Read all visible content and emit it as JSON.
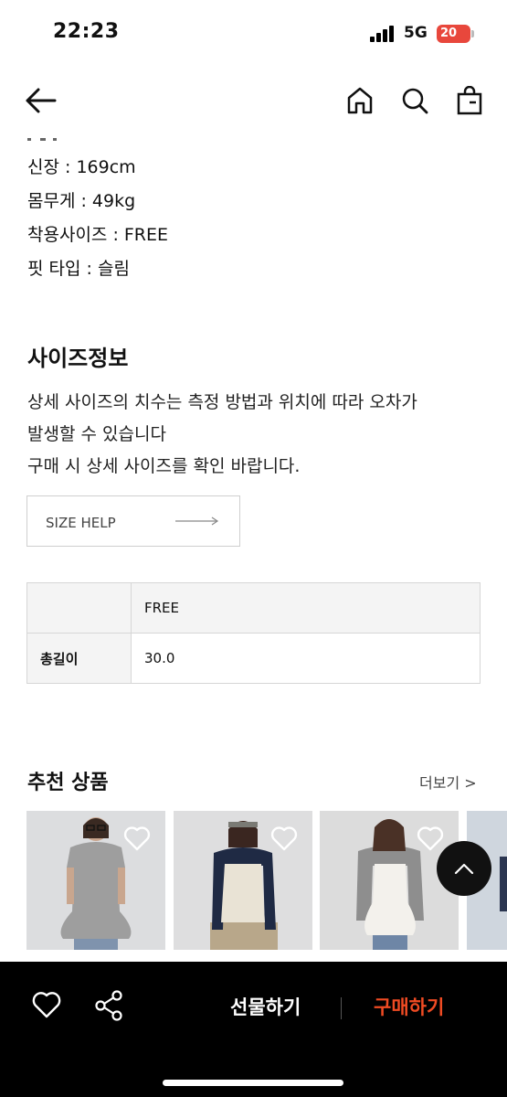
{
  "status": {
    "time": "22:23",
    "network": "5G",
    "battery": "20"
  },
  "specs": [
    "신장 : 169cm",
    "몸무게 : 49kg",
    "착용사이즈 : FREE",
    "핏 타입 : 슬림"
  ],
  "size_info": {
    "title": "사이즈정보",
    "desc": [
      "상세 사이즈의 치수는 측정 방법과 위치에 따라 오차가",
      "발생할 수 있습니다",
      "구매 시 상세 사이즈를 확인 바랍니다."
    ],
    "help_label": "SIZE HELP"
  },
  "size_table": {
    "header": "FREE",
    "row_label": "총길이",
    "row_value": "30.0"
  },
  "recommend": {
    "title": "추천 상품",
    "more": "더보기 >"
  },
  "bottom": {
    "gift": "선물하기",
    "buy": "구매하기"
  },
  "colors": {
    "accent": "#f04b23",
    "bar": "#000000"
  }
}
